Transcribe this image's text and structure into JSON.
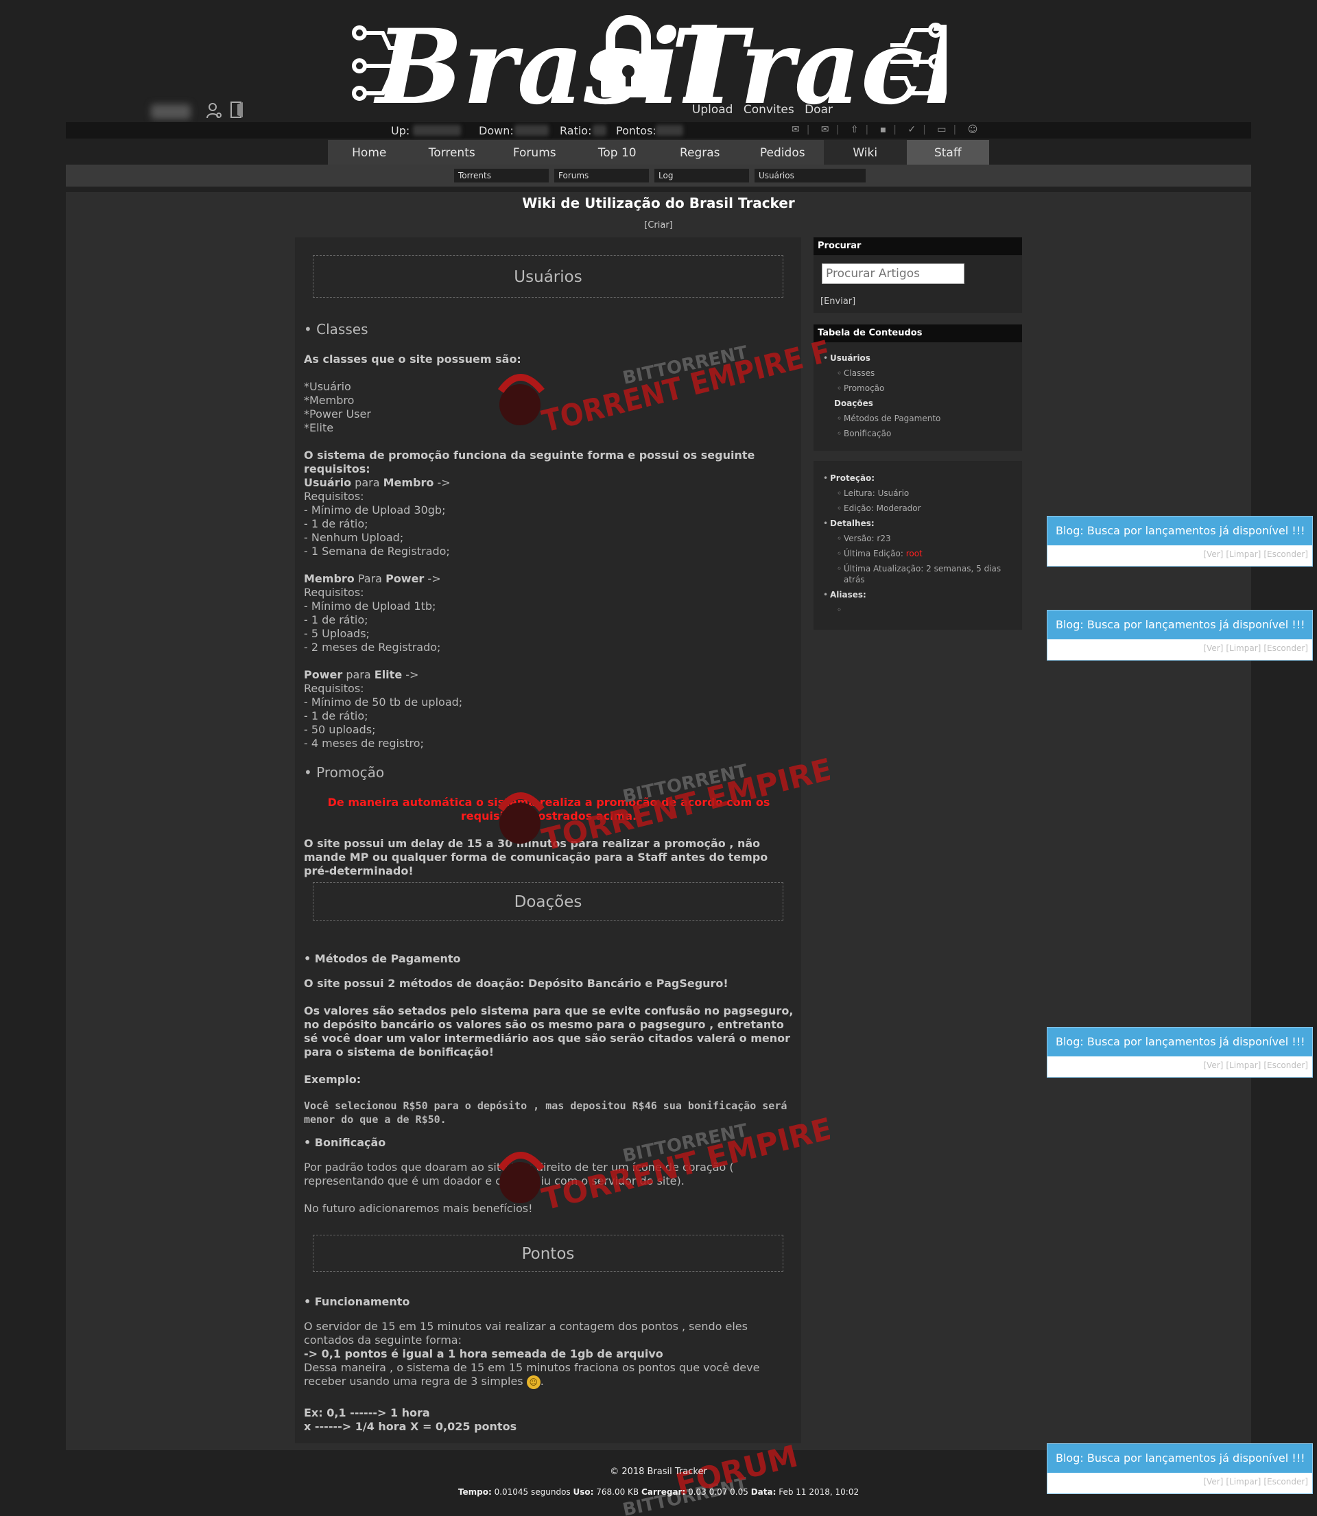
{
  "header": {
    "logo_left": "Brasil",
    "logo_right": "Tracker",
    "top_links": [
      "Upload",
      "Convites",
      "Doar"
    ]
  },
  "statusbar": {
    "up_label": "Up:",
    "down_label": "Down:",
    "ratio_label": "Ratio:",
    "points_label": "Pontos:"
  },
  "nav": {
    "items": [
      "Home",
      "Torrents",
      "Forums",
      "Top 10",
      "Regras",
      "Pedidos",
      "Wiki",
      "Staff"
    ]
  },
  "subnav": {
    "items": [
      "Torrents",
      "Forums",
      "Log",
      "Usuários"
    ]
  },
  "page": {
    "title": "Wiki de Utilização do Brasil Tracker",
    "criar": "[Criar]"
  },
  "article": {
    "usuarios_heading": "Usuários",
    "classes_heading": "• Classes",
    "classes_intro": "As classes que o site possuem são:",
    "classes_list": [
      "*Usuário",
      "*Membro",
      "*Power User",
      "*Elite"
    ],
    "promo_intro": "O sistema de promoção funciona da seguinte forma e possui os seguinte requisitos:",
    "r1_title": "Usuário",
    "r1_para": " para ",
    "r1_to": "Membro",
    "r1_arrow": " ->",
    "r1_req": "Requisitos:",
    "r1_items": [
      "- Mínimo de Upload 30gb;",
      "- 1 de rátio;",
      "- Nenhum Upload;",
      "- 1 Semana de Registrado;"
    ],
    "r2_title": "Membro",
    "r2_para": " Para ",
    "r2_to": "Power",
    "r2_arrow": " ->",
    "r2_req": "Requisitos:",
    "r2_items": [
      "- Mínimo de Upload 1tb;",
      "- 1 de rátio;",
      "- 5 Uploads;",
      "- 2 meses de Registrado;"
    ],
    "r3_title": "Power",
    "r3_para": " para ",
    "r3_to": "Elite",
    "r3_arrow": " ->",
    "r3_req": "Requisitos:",
    "r3_items": [
      "- Mínimo de 50 tb de upload;",
      "- 1 de rátio;",
      "- 50 uploads;",
      "- 4 meses de registro;"
    ],
    "promocao_heading": "• Promoção",
    "promocao_red": "De maneira automática o sistema realiza a promoção de acordo com os requisitos mostrados acima.",
    "promocao_delay": "O site possui um delay de 15 a 30 minutos para realizar a promoção , não mande MP ou qualquer forma de comunicação para a Staff antes do tempo pré-determinado!",
    "doacoes_heading": "Doações",
    "metodos_heading": "• Métodos de Pagamento",
    "metodos_text": "O site possui 2 métodos de doação: Depósito Bancário e PagSeguro!",
    "valores_text": "Os valores são setados pelo sistema para que se evite confusão no pagseguro, no depósito bancário os valores são os mesmo para o pagseguro , entretanto sé você doar um valor intermediário aos que são serão citados valerá o menor para o sistema de bonificação!",
    "exemplo_label": "Exemplo:",
    "exemplo_text": "Você selecionou R$50 para o depósito , mas depositou R$46 sua bonificação será menor do que a de R$50.",
    "bonificacao_heading": "• Bonificação",
    "bonificacao_text": "Por padrão todos que doaram ao site tem direito de ter um ícone de coração ( representando que é um doador e contribuiu com o servidor do site).",
    "futuro_text": "No futuro adicionaremos mais benefícios!",
    "pontos_heading": "Pontos",
    "funcionamento_heading": "• Funcionamento",
    "func_text1": "O servidor de 15 em 15 minutos vai realizar a contagem dos pontos , sendo eles contados da seguinte forma:",
    "func_arrow": "-> ",
    "func_bold": "0,1 pontos é igual a 1 hora semeada de 1gb de arquivo",
    "func_text2": "Dessa maneira , o sistema de 15 em 15 minutos fraciona os pontos que você deve receber usando uma regra de 3 simples",
    "func_end": ".",
    "ex_line1": "Ex: 0,1 ------> 1 hora",
    "ex_line2": "x ------> 1/4 hora X = 0,025 pontos"
  },
  "sidebar": {
    "search_title": "Procurar",
    "search_placeholder": "Procurar Artigos",
    "search_button": "[Enviar]",
    "toc_title": "Tabela de Conteudos",
    "toc": {
      "usuarios": "Usuários",
      "classes": "Classes",
      "promocao": "Promoção",
      "doacoes": "Doações",
      "metodos": "Métodos de Pagamento",
      "bonificacao": "Bonificação"
    },
    "info": {
      "protecao": "Proteção:",
      "leitura": "Leitura: Usuário",
      "edicao": "Edição: Moderador",
      "detalhes": "Detalhes:",
      "versao": "Versão: r23",
      "ultima_edicao_label": "Última Edição: ",
      "ultima_edicao_user": "root",
      "ultima_atualizacao": "Última Atualização: 2 semanas, 5 dias atrás",
      "aliases": "Aliases:"
    }
  },
  "blog_popup": {
    "title": "Blog: Busca por lançamentos já disponível !!!",
    "ver": "[Ver]",
    "limpar": "[Limpar]",
    "esconder": "[Esconder]"
  },
  "watermark": {
    "line1": "BITTORRENT",
    "line2": "TORRENT EMPIRE FORUM"
  },
  "footer": {
    "copyright": "© 2018 Brasil Tracker",
    "tempo_label": "Tempo:",
    "tempo_value": " 0.01045 segundos ",
    "uso_label": "Uso:",
    "uso_value": " 768.00 KB ",
    "carregar_label": "Carregar:",
    "carregar_value": " 0.03 0.07 0.05 ",
    "data_label": "Data:",
    "data_value": " Feb 11 2018, 10:02"
  },
  "colors": {
    "blog_accent": "#4aa9dd",
    "highlight_red": "#ff1a1a",
    "background": "#212121"
  }
}
